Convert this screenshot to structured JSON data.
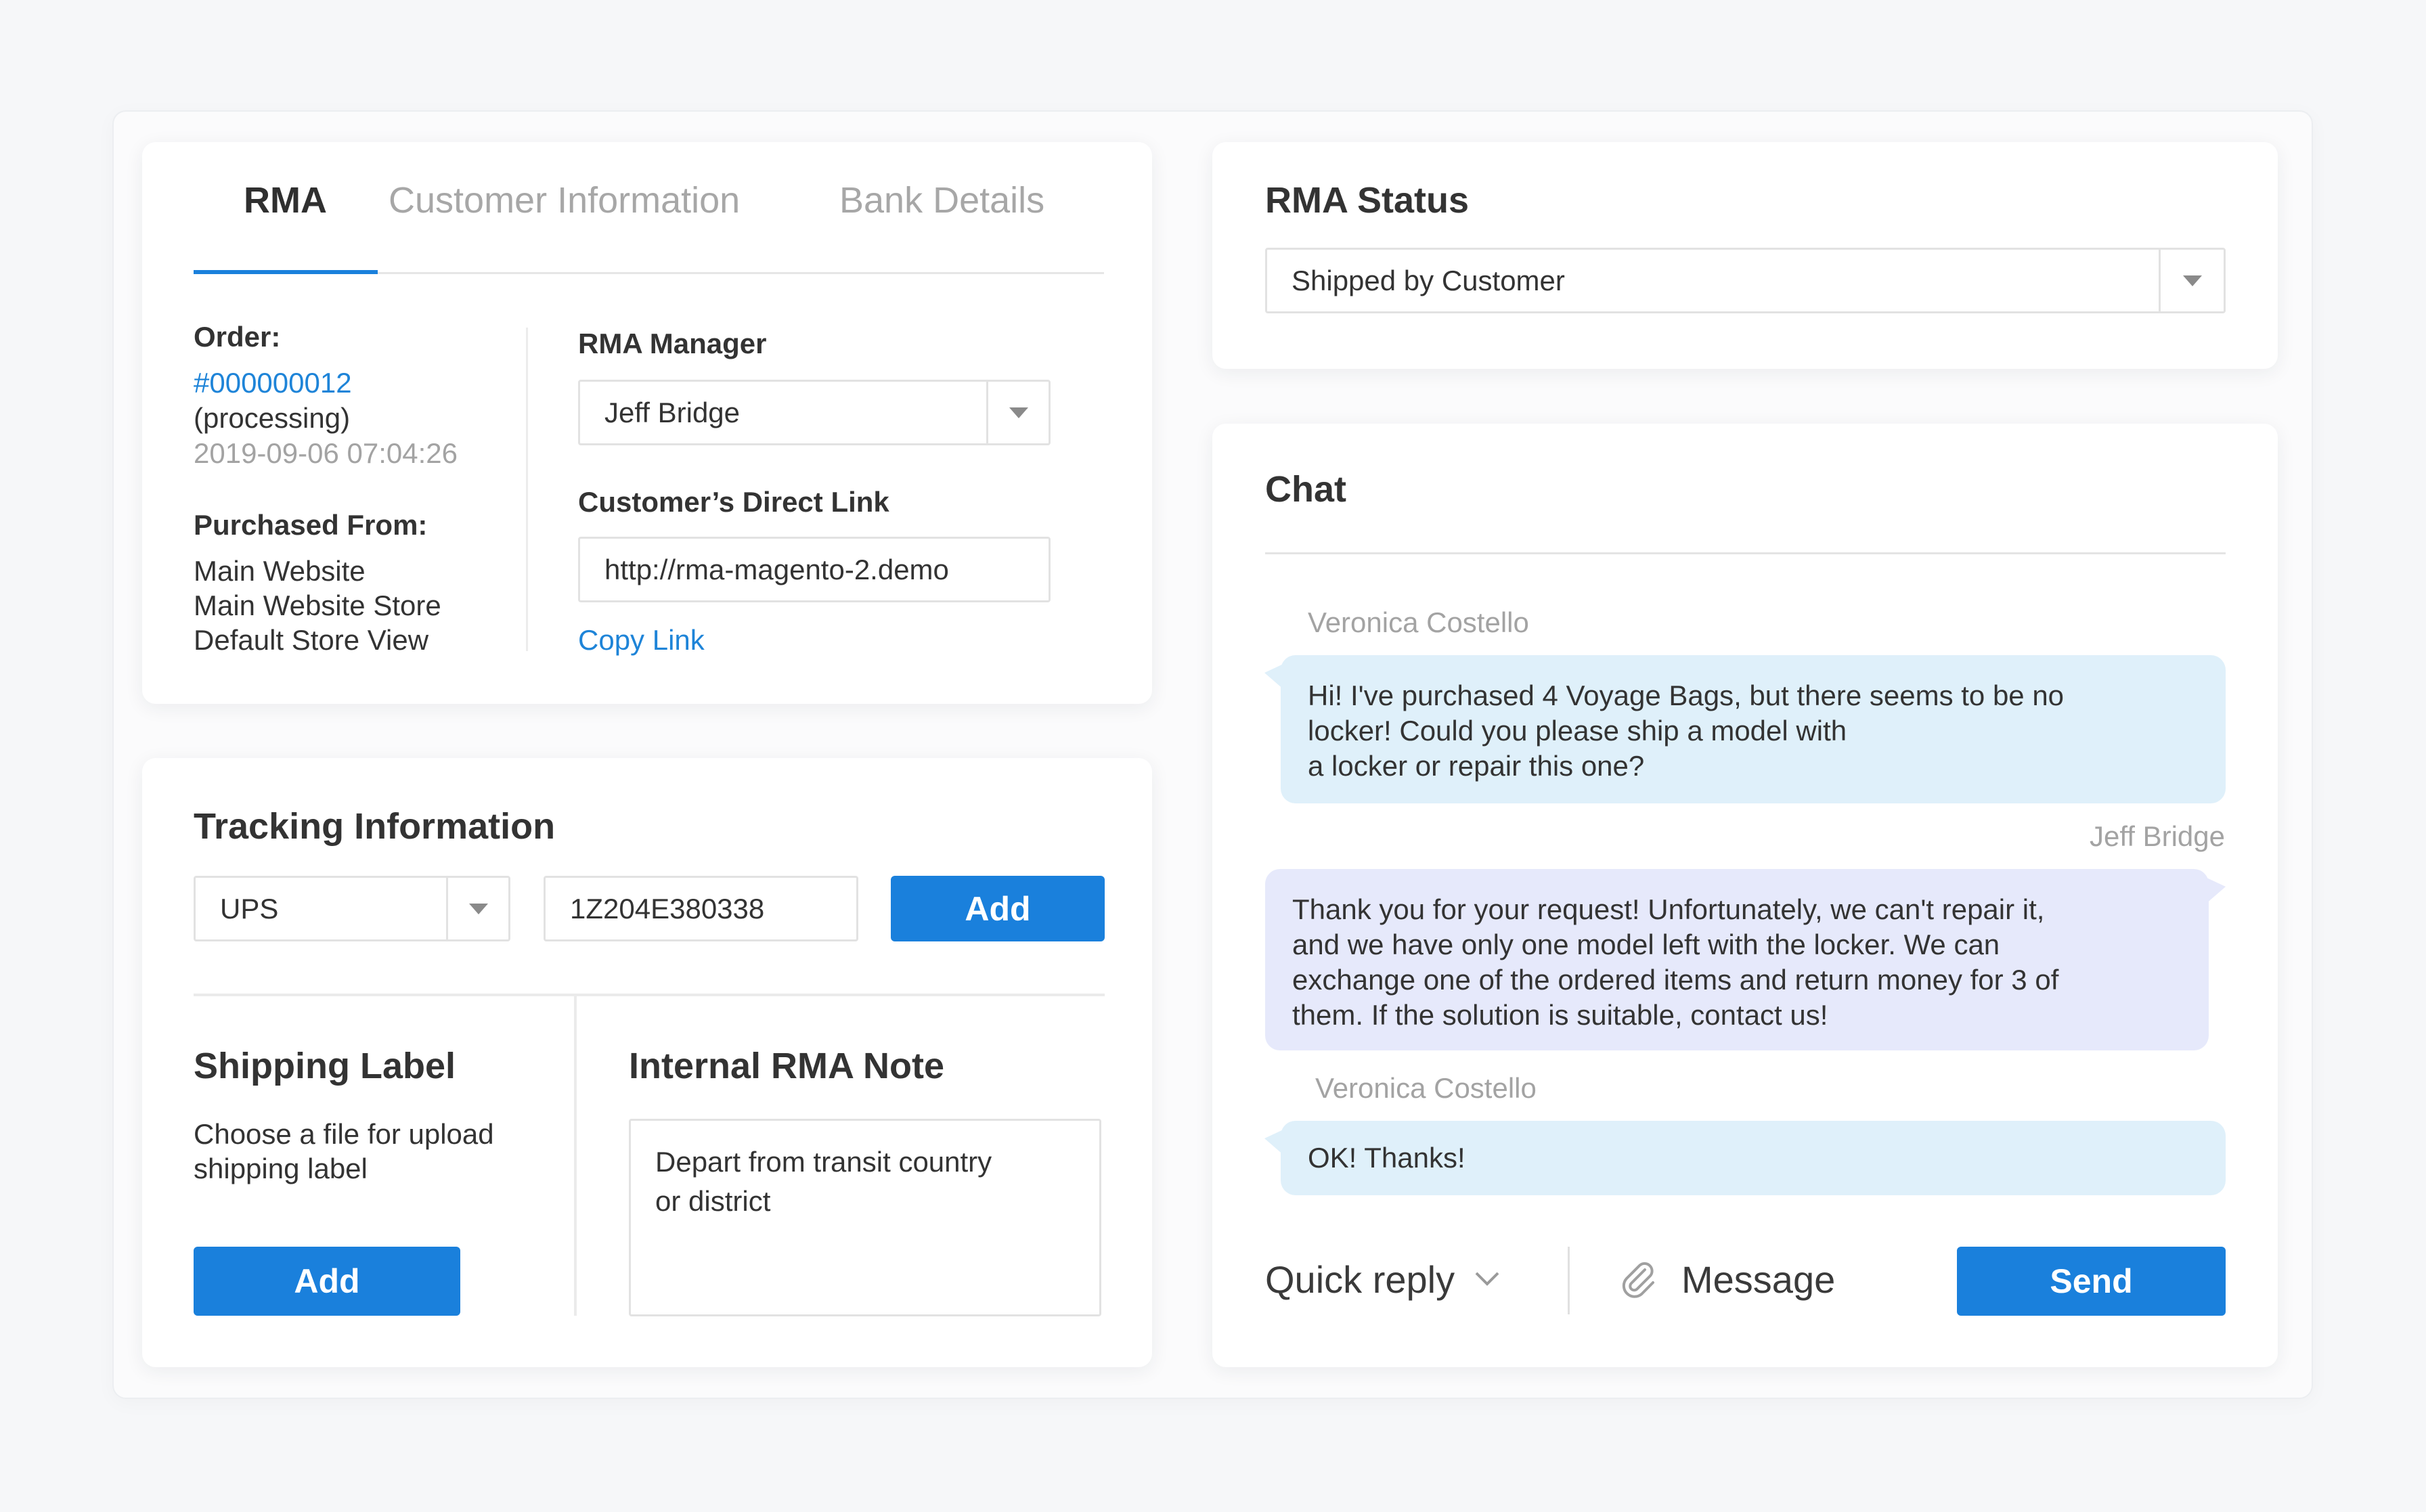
{
  "tabs": [
    {
      "label": "RMA",
      "active": true
    },
    {
      "label": "Customer Information",
      "active": false
    },
    {
      "label": "Bank Details",
      "active": false
    }
  ],
  "order": {
    "label": "Order:",
    "number": "#000000012",
    "status": "(processing)",
    "date": "2019-09-06 07:04:26",
    "purchased_label": "Purchased From:",
    "purchased_lines": [
      "Main Website",
      "Main Website Store",
      "Default Store View"
    ]
  },
  "manager": {
    "label": "RMA Manager",
    "value": "Jeff Bridge"
  },
  "direct_link": {
    "label": "Customer’s Direct Link",
    "value": "http://rma-magento-2.demo",
    "copy_label": "Copy Link"
  },
  "tracking": {
    "title": "Tracking Information",
    "carrier": "UPS",
    "number": "1Z204E380338",
    "add_label": "Add"
  },
  "shipping_label": {
    "title": "Shipping Label",
    "desc_lines": [
      "Choose a file for upload",
      "shipping label"
    ],
    "add_label": "Add"
  },
  "note": {
    "title": "Internal RMA Note",
    "lines": [
      "Depart from transit country",
      "or district"
    ]
  },
  "status": {
    "title": "RMA Status",
    "value": "Shipped by Customer"
  },
  "chat": {
    "title": "Chat",
    "messages": [
      {
        "author": "Veronica Costello",
        "lines": [
          "Hi! I've purchased 4 Voyage Bags, but there seems to be no",
          "locker! Could you please ship a model with",
          "a locker or repair this one?"
        ]
      },
      {
        "author": "Jeff Bridge",
        "lines": [
          "Thank you for your request! Unfortunately, we can't repair it,",
          "and we have only one model left with the locker. We can",
          "exchange one of the ordered items and return money for 3 of",
          "them. If the solution is suitable, contact us!"
        ]
      },
      {
        "author": "Veronica Costello",
        "lines": [
          "OK! Thanks!"
        ]
      }
    ],
    "quick_reply": "Quick reply",
    "message_placeholder": "Message",
    "send_label": "Send"
  },
  "colors": {
    "accent": "#1a80dc",
    "link": "#1e84d8",
    "incoming_bubble": "#dff0fa",
    "outgoing_bubble": "#e6e9fb"
  }
}
